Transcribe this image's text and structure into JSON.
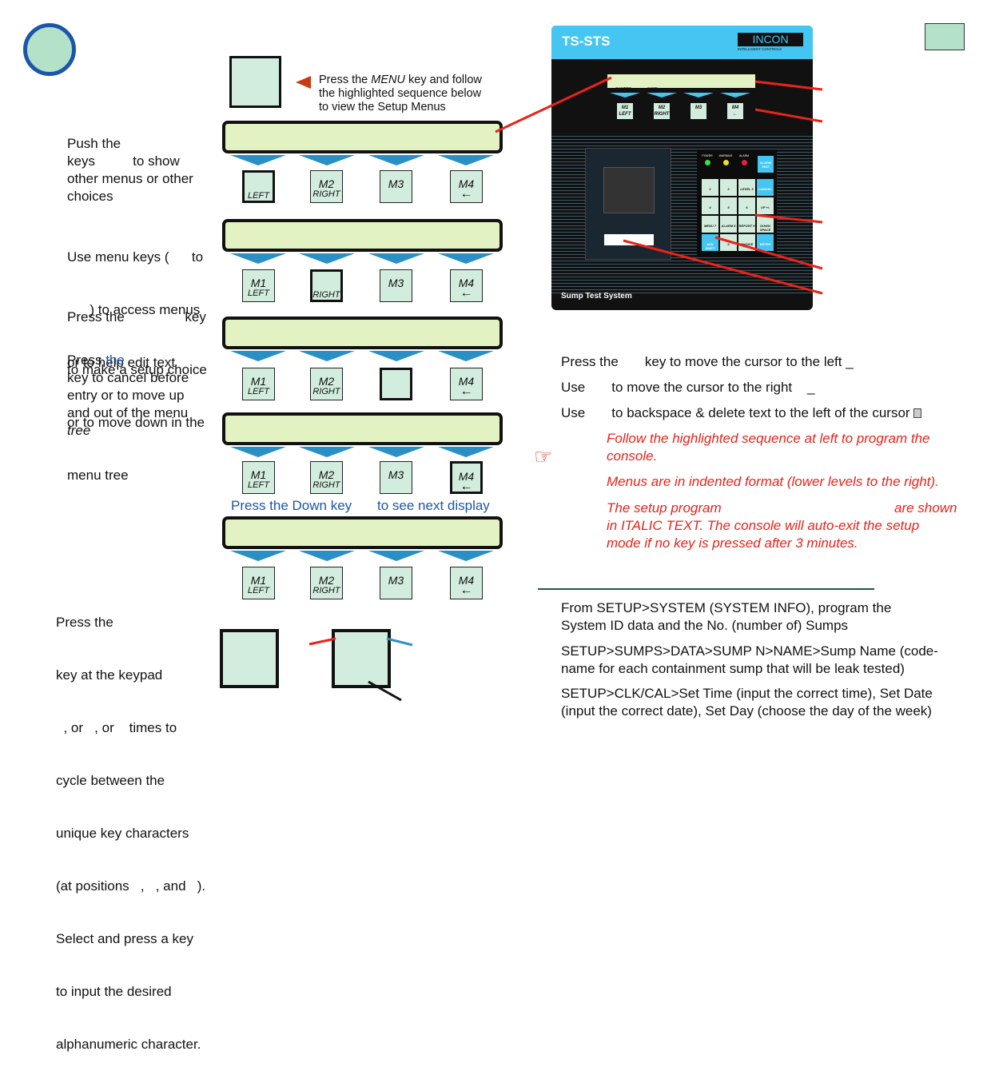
{
  "intro": {
    "arrow_text_1": "Press the ",
    "arrow_text_menu": "MENU",
    "arrow_text_2": " key and follow",
    "arrow_text_line2": "the highlighted sequence below",
    "arrow_text_line3": "to view the Setup Menus"
  },
  "left_notes": [
    [
      "Push the",
      "keys          to show",
      "other menus or other",
      "choices"
    ],
    [
      "Use menu keys (      to",
      "      ) to access menus",
      "or to help edit text"
    ],
    [
      "Press the                key",
      "to make a setup choice",
      "or to move down in the",
      "menu tree"
    ],
    [
      "Press the",
      "key to cancel before",
      "entry or to move up",
      "and out of the menu",
      "tree"
    ],
    [
      "Press the",
      "key at the keypad",
      "  , or   , or    times to",
      "cycle between the",
      "unique key characters",
      "(at positions   ,   , and   ).",
      "Select and press a key",
      "to input the desired",
      "alphanumeric character."
    ]
  ],
  "press_the_word": "the",
  "down_key_hint": {
    "left": "Press the Down key",
    "right": "to see next display"
  },
  "key_rows": [
    [
      {
        "top": "",
        "bottom": "LEFT",
        "hl": true
      },
      {
        "top": "M2",
        "bottom": "RIGHT"
      },
      {
        "top": "M3",
        "bottom": ""
      },
      {
        "top": "M4",
        "bottom": "←"
      }
    ],
    [
      {
        "top": "M1",
        "bottom": "LEFT"
      },
      {
        "top": "",
        "bottom": "RIGHT",
        "hl": true
      },
      {
        "top": "M3",
        "bottom": ""
      },
      {
        "top": "M4",
        "bottom": "←"
      }
    ],
    [
      {
        "top": "M1",
        "bottom": "LEFT"
      },
      {
        "top": "M2",
        "bottom": "RIGHT"
      },
      {
        "top": "",
        "bottom": "",
        "hl": true
      },
      {
        "top": "M4",
        "bottom": "←"
      }
    ],
    [
      {
        "top": "M1",
        "bottom": "LEFT"
      },
      {
        "top": "M2",
        "bottom": "RIGHT"
      },
      {
        "top": "M3",
        "bottom": ""
      },
      {
        "top": "M4",
        "bottom": "←",
        "hl": true
      }
    ],
    [
      {
        "top": "M1",
        "bottom": "LEFT"
      },
      {
        "top": "M2",
        "bottom": "RIGHT"
      },
      {
        "top": "M3",
        "bottom": ""
      },
      {
        "top": "M4",
        "bottom": "←"
      }
    ]
  ],
  "console": {
    "model": "TS-STS",
    "brand": "INCON",
    "brand_sub": "INTELLIGENT CONTROLS",
    "lcd_line1": "SYSTEM      SUMP",
    "lcd_line2": "WARNING     OKAY",
    "keys": [
      {
        "top": "M1",
        "bottom": "LEFT"
      },
      {
        "top": "M2",
        "bottom": "RIGHT"
      },
      {
        "top": "M3",
        "bottom": ""
      },
      {
        "top": "M4",
        "bottom": "←"
      }
    ],
    "leds": [
      {
        "label": "POWER",
        "color": "#3ee03e"
      },
      {
        "label": "WARNING",
        "color": "#f2e21a"
      },
      {
        "label": "ALARM",
        "color": "#ec1f3c"
      }
    ],
    "alarm_test": "ALARM TEST",
    "keypad": [
      "1",
      "2",
      "LEVEL 3",
      "CANCEL",
      "4",
      "5",
      "6",
      "UP +/-",
      "MENU 7",
      "ALARM 8",
      "REPORT 9",
      "DOWN SPACE",
      "ACK SHIFT",
      "0",
      "CHOICE",
      "ENTER"
    ],
    "footer": "Sump Test System"
  },
  "cursor_help": [
    {
      "a": "Press the",
      "b": "key to move the cursor to the left _"
    },
    {
      "a": "Use",
      "b": "to move the cursor to the right    _"
    },
    {
      "a": "Use",
      "b": "to backspace & delete text to the left of the cursor"
    }
  ],
  "notes_red": {
    "p1": "Follow the highlighted sequence at left to program the console.",
    "p2": "Menus are in indented format (lower levels to the right).",
    "p3a": "The setup program",
    "p3b": "are shown",
    "p3c": "in ITALIC TEXT.  The console will auto-exit the setup mode if no key is pressed after 3 minutes."
  },
  "setup_steps": [
    "From SETUP>SYSTEM (SYSTEM INFO), program the System ID data and the No. (number of) Sumps",
    "SETUP>SUMPS>DATA>SUMP N>NAME>Sump Name (code-name for each containment sump that will be leak tested)",
    "SETUP>CLK/CAL>Set Time  (input the correct time), Set Date (input the correct date), Set Day (choose the day of the week)"
  ],
  "colors": {
    "accent_blue": "#2a8fc4",
    "red": "#e8231a",
    "key_fill": "#d2ecdd",
    "display_fill": "#e2f2c2"
  }
}
